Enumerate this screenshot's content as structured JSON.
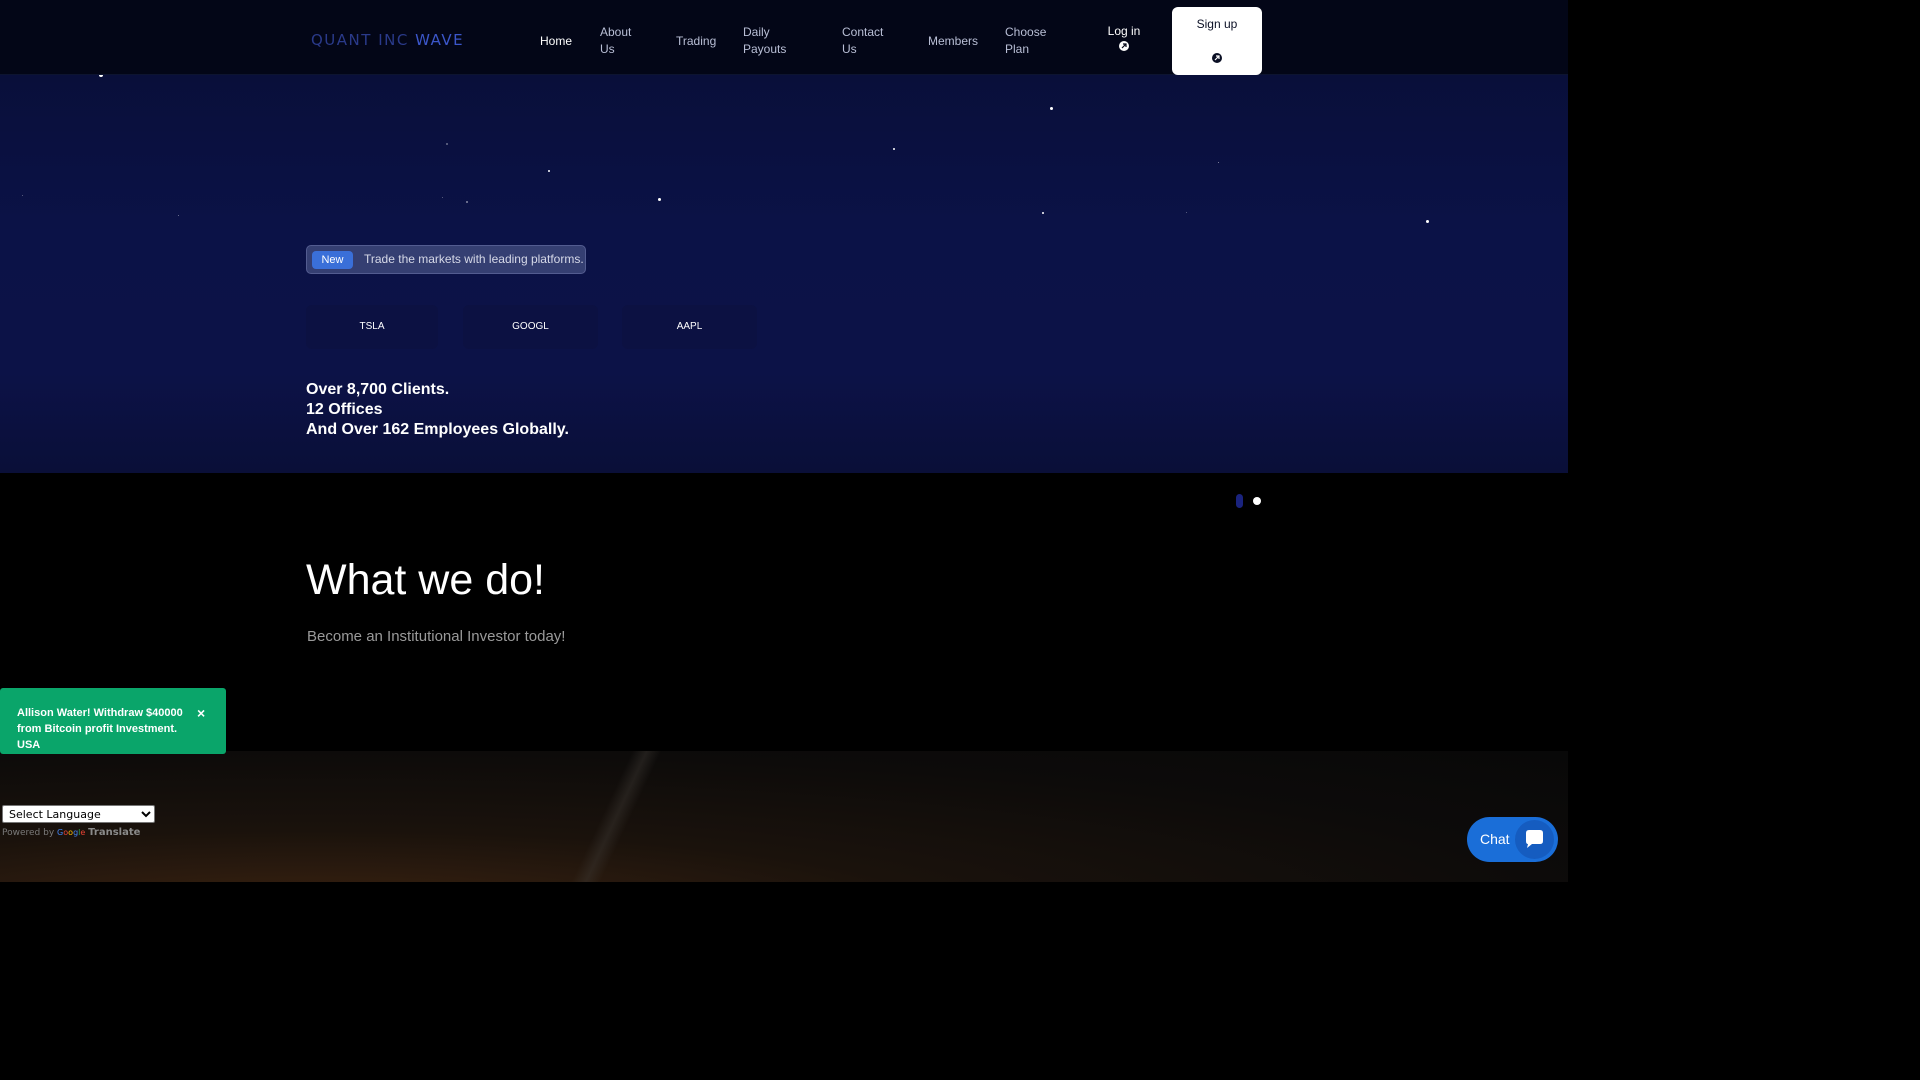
{
  "header": {
    "logo_main": "QUANT INC ",
    "logo_accent": "WAVE",
    "nav": [
      {
        "label": "Home"
      },
      {
        "label": "About Us"
      },
      {
        "label": "Trading"
      },
      {
        "label": "Daily Payouts"
      },
      {
        "label": "Contact Us"
      },
      {
        "label": "Members"
      },
      {
        "label": "Choose Plan"
      }
    ],
    "login_label": "Log in",
    "signup_label": "Sign up"
  },
  "hero": {
    "badge_tag": "New",
    "badge_text": "Trade the markets with leading platforms.",
    "tickers": [
      "TSLA",
      "GOOGL",
      "AAPL"
    ],
    "stats": [
      "Over 8,700 Clients.",
      "12 Offices",
      "And Over 162 Employees Globally."
    ]
  },
  "section": {
    "title": "What we do!",
    "subtitle": "Become an Institutional Investor today!"
  },
  "notification": {
    "text": "Allison Water! Withdraw $40000 from Bitcoin profit Investment. USA",
    "close": "×"
  },
  "translate": {
    "select_value": "Select Language",
    "powered_by": "Powered by",
    "google": "Google",
    "translate_label": "Translate"
  },
  "chat": {
    "label": "Chat"
  },
  "colors": {
    "signup_bg": "#ffffff",
    "badge_new": "#3a6fd8",
    "notification_bg": "#0aa56a",
    "chat_bg": "#1a6ed8",
    "hero_bg": "#0b1247"
  }
}
